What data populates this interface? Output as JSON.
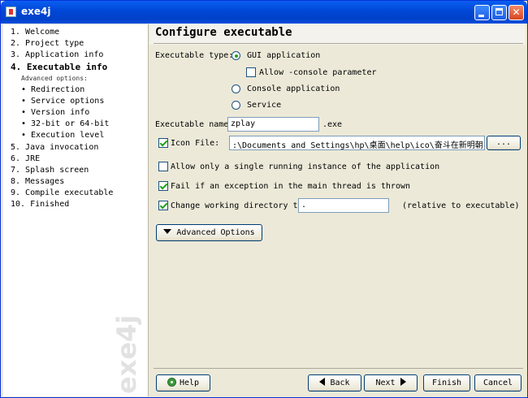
{
  "window": {
    "title": "exe4j"
  },
  "sidebar": {
    "steps": [
      "1. Welcome",
      "2. Project type",
      "3. Application info",
      "4. Executable info",
      "5. Java invocation",
      "6. JRE",
      "7. Splash screen",
      "8. Messages",
      "9. Compile executable",
      "10. Finished"
    ],
    "advanced_heading": "Advanced options:",
    "substeps": [
      "• Redirection",
      "• Service options",
      "• Version info",
      "• 32-bit or 64-bit",
      "• Execution level"
    ],
    "watermark": "exe4j"
  },
  "page": {
    "title": "Configure executable",
    "executable_type_label": "Executable type:",
    "gui_option": "GUI application",
    "allow_console_label": "Allow -console parameter",
    "console_option": "Console application",
    "service_option": "Service",
    "executable_name_label": "Executable name:",
    "executable_name_value": "zplay",
    "exe_suffix": ".exe",
    "icon_file_label": "Icon File:",
    "icon_file_value": ":\\Documents and Settings\\hp\\桌面\\help\\ico\\奋斗在新明朝.ico",
    "browse_label": "...",
    "single_instance_label": "Allow only a single running instance of the application",
    "fail_exception_label": "Fail if an exception in the main thread is thrown",
    "change_dir_label": "Change working directory to:",
    "change_dir_value": ".",
    "relative_note": "(relative to executable)",
    "advanced_options_label": "Advanced Options"
  },
  "footer": {
    "help": "Help",
    "back": "Back",
    "next": "Next",
    "finish": "Finish",
    "cancel": "Cancel"
  }
}
